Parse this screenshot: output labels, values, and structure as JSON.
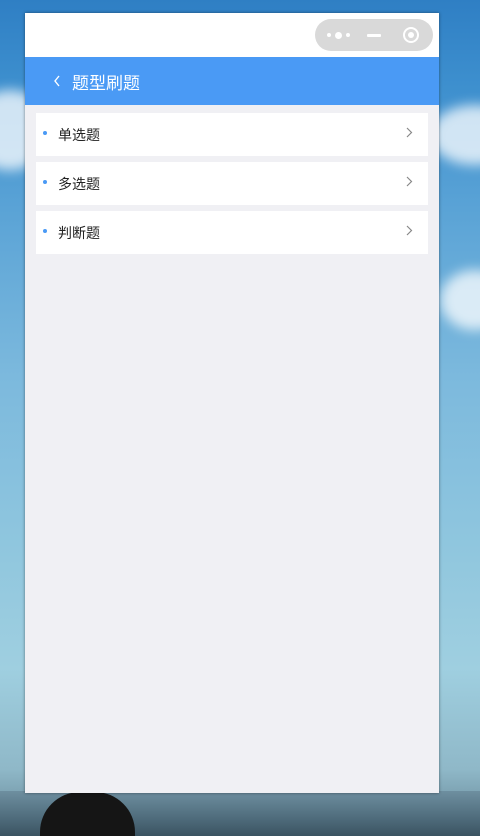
{
  "window": {
    "capsule": {
      "more_icon": "more-dots-icon",
      "minimize_icon": "minimize-icon",
      "close_icon": "close-circle-icon"
    }
  },
  "header": {
    "back_icon": "chevron-left-icon",
    "title": "题型刷题",
    "background_color": "#4a9af5"
  },
  "question_types": [
    {
      "label": "单选题",
      "icon": "chevron-right-icon"
    },
    {
      "label": "多选题",
      "icon": "chevron-right-icon"
    },
    {
      "label": "判断题",
      "icon": "chevron-right-icon"
    }
  ],
  "colors": {
    "accent": "#4a9af5",
    "page_background": "#f0f0f4",
    "item_background": "#ffffff",
    "text": "#222222"
  }
}
